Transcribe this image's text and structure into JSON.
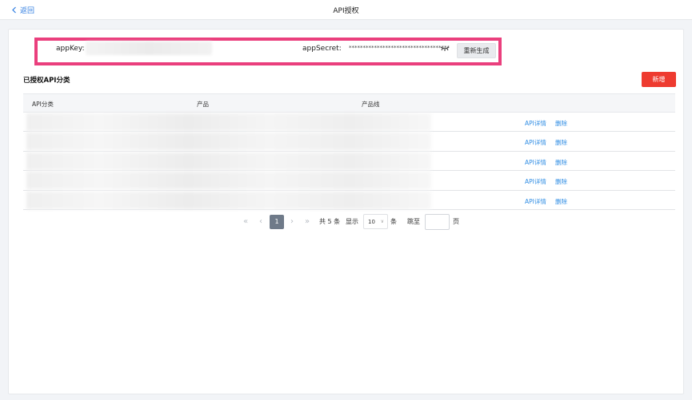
{
  "header": {
    "back_label": "返回",
    "title": "API授权"
  },
  "credentials": {
    "app_key_label": "appKey:",
    "app_secret_label": "appSecret:",
    "app_secret_masked": "************************************",
    "regenerate_label": "重新生成"
  },
  "section": {
    "title": "已授权API分类",
    "add_label": "新增"
  },
  "table": {
    "columns": [
      "API分类",
      "产品",
      "产品线"
    ],
    "rows": [
      {
        "detail": "API详情",
        "delete": "删除"
      },
      {
        "detail": "API详情",
        "delete": "删除"
      },
      {
        "detail": "API详情",
        "delete": "删除"
      },
      {
        "detail": "API详情",
        "delete": "删除"
      },
      {
        "detail": "API详情",
        "delete": "删除"
      }
    ]
  },
  "pagination": {
    "first": "«",
    "prev": "‹",
    "current_page": "1",
    "next": "›",
    "last": "»",
    "total_text": "共 5 条",
    "show_label": "显示",
    "page_size": "10",
    "items_unit": "条",
    "jump_label": "跳至",
    "page_unit": "页"
  },
  "colors": {
    "accent": "#2f8de4",
    "danger": "#ee3b30",
    "highlight": "#ea3f7d"
  }
}
